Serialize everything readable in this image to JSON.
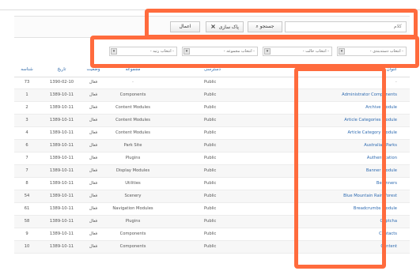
{
  "toolbar": {
    "search_placeholder": "کلام",
    "search_label": "جستجو",
    "clear_label": "پاک سازی",
    "apply_label": "اعمال"
  },
  "filters": {
    "category": "- انتخاب دسته‌بندی -",
    "status": "- انتخاب حالت -",
    "section": "- انتخاب مجموعه -",
    "access": "- انتخاب رتبه -"
  },
  "headers": {
    "id": "شناسه",
    "date": "تاریخ",
    "status": "وضعیت",
    "section": "مجموعه",
    "access": "دسترسی",
    "title": "عنوان"
  },
  "rows": [
    {
      "id": "73",
      "date": "1390-02-10",
      "status": "فعال",
      "section": "-",
      "access": "Public",
      "title": "-"
    },
    {
      "id": "1",
      "date": "1389-10-11",
      "status": "فعال",
      "section": "Components",
      "access": "Public",
      "title": "Administrator Components"
    },
    {
      "id": "2",
      "date": "1389-10-11",
      "status": "فعال",
      "section": "Content Modules",
      "access": "Public",
      "title": "Archive Module"
    },
    {
      "id": "3",
      "date": "1389-10-11",
      "status": "فعال",
      "section": "Content Modules",
      "access": "Public",
      "title": "Article Categories Module"
    },
    {
      "id": "4",
      "date": "1389-10-11",
      "status": "فعال",
      "section": "Content Modules",
      "access": "Public",
      "title": "Article Category Module"
    },
    {
      "id": "6",
      "date": "1389-10-11",
      "status": "فعال",
      "section": "Park Site",
      "access": "Public",
      "title": "Australian Parks"
    },
    {
      "id": "7",
      "date": "1389-10-11",
      "status": "فعال",
      "section": "Plugins",
      "access": "Public",
      "title": "Authentication"
    },
    {
      "id": "7",
      "date": "1389-10-11",
      "status": "فعال",
      "section": "Display Modules",
      "access": "Public",
      "title": "Banner Module"
    },
    {
      "id": "8",
      "date": "1389-10-11",
      "status": "فعال",
      "section": "Utilities",
      "access": "Public",
      "title": "Beginners"
    },
    {
      "id": "54",
      "date": "1389-10-11",
      "status": "فعال",
      "section": "Scenery",
      "access": "Public",
      "title": "Blue Mountain Rain Forest"
    },
    {
      "id": "61",
      "date": "1389-10-11",
      "status": "فعال",
      "section": "Navigation Modules",
      "access": "Public",
      "title": "Breadcrumbs Module"
    },
    {
      "id": "58",
      "date": "1389-10-11",
      "status": "فعال",
      "section": "Plugins",
      "access": "Public",
      "title": "Captcha"
    },
    {
      "id": "9",
      "date": "1389-10-11",
      "status": "فعال",
      "section": "Components",
      "access": "Public",
      "title": "Contacts"
    },
    {
      "id": "10",
      "date": "1389-10-11",
      "status": "فعال",
      "section": "Components",
      "access": "Public",
      "title": "Content"
    }
  ]
}
